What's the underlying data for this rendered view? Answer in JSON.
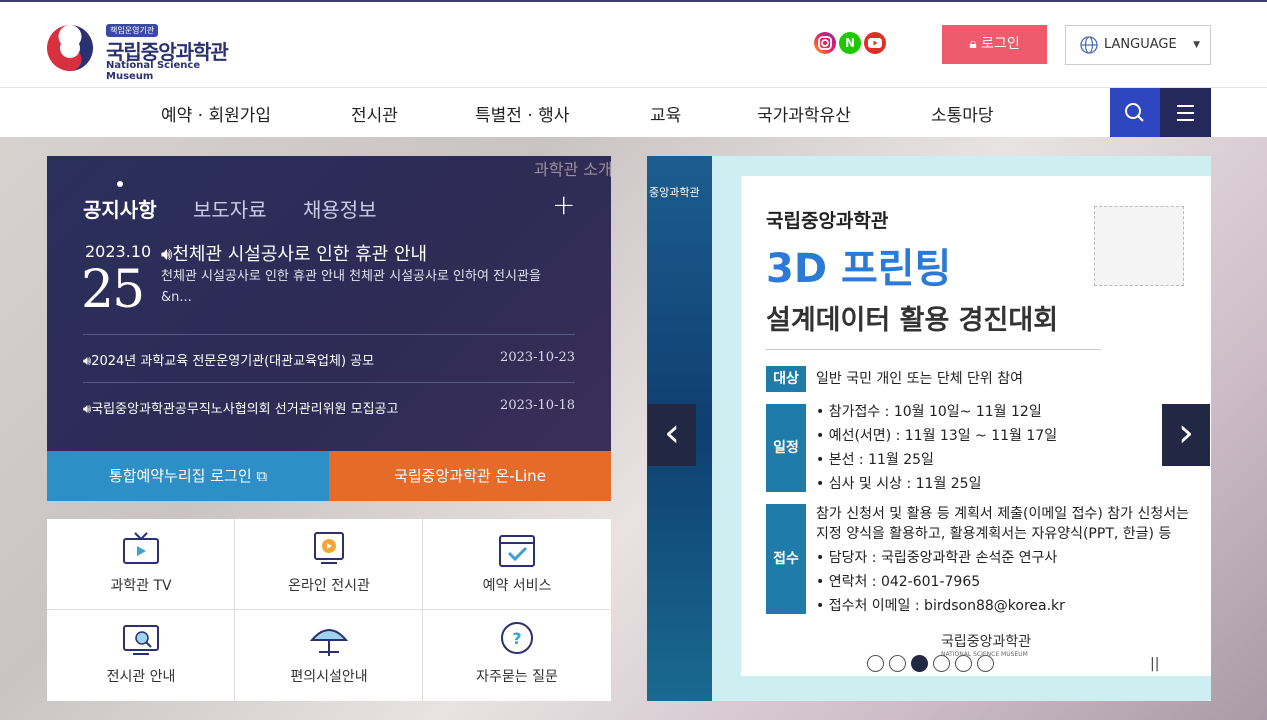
{
  "header": {
    "logo_badge": "책임운영기관",
    "logo_name": "국립중앙과학관",
    "logo_en": "National Science Museum",
    "sns": [
      {
        "name": "instagram",
        "icon": "instagram-icon"
      },
      {
        "name": "blog",
        "label": "N"
      },
      {
        "name": "youtube",
        "icon": "youtube-icon"
      }
    ],
    "login_label": "로그인",
    "language_label": "LANGUAGE"
  },
  "nav": {
    "items": [
      "예약 · 회원가입",
      "전시관",
      "특별전 · 행사",
      "교육",
      "국가과학유산",
      "소통마당"
    ]
  },
  "ghost_text": "과학관 소개",
  "notice": {
    "tabs": [
      "공지사항",
      "보도자료",
      "채용정보"
    ],
    "featured": {
      "year_month": "2023.10",
      "day": "25",
      "title": "천체관 시설공사로 인한 휴관 안내",
      "summary": "천체관 시설공사로 인한 휴관 안내 천체관 시설공사로 인하여 전시관을 &n..."
    },
    "items": [
      {
        "title": "2024년 과학교육 전문운영기관(대관교육업체) 공모",
        "date": "2023-10-23"
      },
      {
        "title": "국립중앙과학관공무직노사협의회 선거관리위원 모집공고",
        "date": "2023-10-18"
      }
    ]
  },
  "buttons": {
    "reservation_login": "통합예약누리집 로그인",
    "online": "국립중앙과학관 온-Line"
  },
  "quick": [
    {
      "label": "과학관 TV",
      "icon": "tv-icon"
    },
    {
      "label": "온라인 전시관",
      "icon": "online-exhibit-icon"
    },
    {
      "label": "예약 서비스",
      "icon": "calendar-icon"
    },
    {
      "label": "전시관 안내",
      "icon": "monitor-search-icon"
    },
    {
      "label": "편의시설안내",
      "icon": "umbrella-icon"
    },
    {
      "label": "자주묻는 질문",
      "icon": "question-icon"
    }
  ],
  "banner": {
    "org": "국립중앙과학관",
    "heading": "3D 프린팅",
    "subheading": "설계데이터 활용 경진대회",
    "target_tag": "대상",
    "target_text": "일반 국민 개인 또는 단체 단위 참여",
    "schedule_tag": "일정",
    "schedule": [
      "• 참가접수 : 10월 10일~ 11월 12일",
      "• 예선(서면) : 11월 13일 ~ 11월 17일",
      "• 본선 : 11월 25일",
      "• 심사 및 시상 : 11월 25일"
    ],
    "submit_tag": "접수",
    "submit": [
      "참가 신청서 및 활용 등 계획서 제출(이메일 접수) 참가 신청서는",
      "지정 양식을 활용하고, 활용계획서는 자유양식(PPT, 한글) 등",
      "• 담당자 : 국립중앙과학관 손석준 연구사",
      "• 연락처 : 042-601-7965",
      "• 접수처 이메일 : birdson88@korea.kr"
    ],
    "footer_logo": "국립중앙과학관",
    "footer_logo_en": "NATIONAL SCIENCE MUSEUM",
    "side_text": "중앙과학관"
  },
  "colors": {
    "brand_navy": "#2b3170",
    "login_pink": "#ee5b6c",
    "nav_blue": "#2e46c0",
    "panel_navy": "#2b2f5c",
    "btn_blue": "#2e8fc6",
    "btn_orange": "#e56b2b"
  }
}
